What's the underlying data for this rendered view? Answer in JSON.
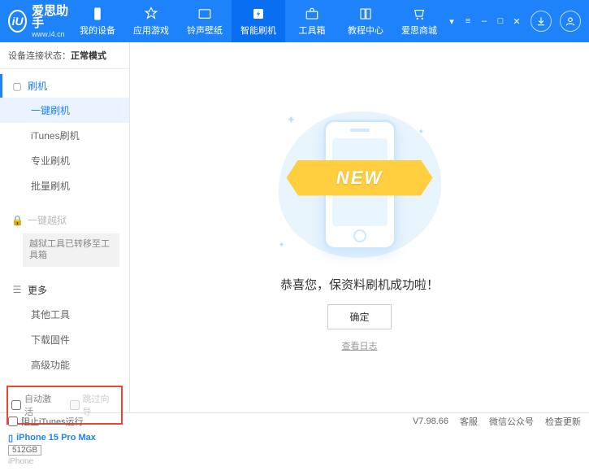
{
  "app": {
    "name": "爱思助手",
    "site": "www.i4.cn",
    "logo_letter": "iU"
  },
  "nav": {
    "items": [
      {
        "label": "我的设备"
      },
      {
        "label": "应用游戏"
      },
      {
        "label": "铃声壁纸"
      },
      {
        "label": "智能刷机"
      },
      {
        "label": "工具箱"
      },
      {
        "label": "教程中心"
      },
      {
        "label": "爱思商城"
      }
    ],
    "active_index": 3
  },
  "sidebar": {
    "conn_label": "设备连接状态：",
    "conn_value": "正常模式",
    "sec_flash": {
      "title": "刷机",
      "items": [
        "一键刷机",
        "iTunes刷机",
        "专业刷机",
        "批量刷机"
      ],
      "selected_index": 0
    },
    "sec_jailbreak": {
      "title": "一键越狱",
      "note": "越狱工具已转移至工具箱"
    },
    "sec_more": {
      "title": "更多",
      "items": [
        "其他工具",
        "下载固件",
        "高级功能"
      ]
    },
    "checks": {
      "auto_activate": "自动激活",
      "skip_guide": "跳过向导"
    },
    "device": {
      "name": "iPhone 15 Pro Max",
      "storage": "512GB",
      "type": "iPhone"
    }
  },
  "main": {
    "ribbon": "NEW",
    "success": "恭喜您，保资料刷机成功啦！",
    "ok": "确定",
    "view_log": "查看日志"
  },
  "footer": {
    "block_itunes": "阻止iTunes运行",
    "version": "V7.98.66",
    "links": [
      "客服",
      "微信公众号",
      "检查更新"
    ]
  }
}
